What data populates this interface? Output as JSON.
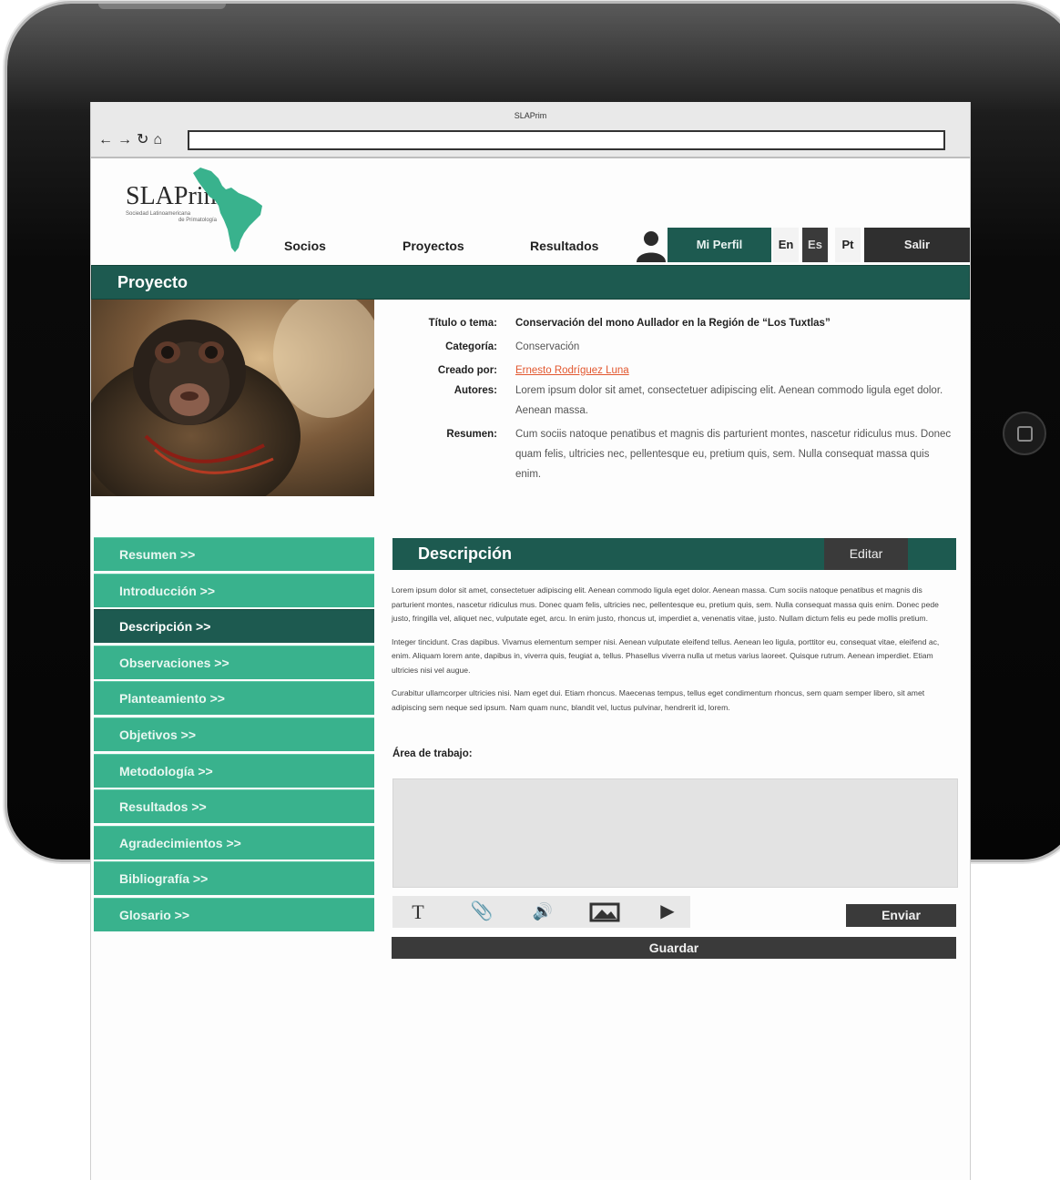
{
  "browser": {
    "title": "SLAPrim",
    "address": ""
  },
  "logo": {
    "name": "SLAPrim",
    "subtitle_line1": "Sociedad Latinoamericana",
    "subtitle_line2": "de Primatología"
  },
  "nav": {
    "socios": "Socios",
    "proyectos": "Proyectos",
    "resultados": "Resultados",
    "profile": "Mi Perfil",
    "lang_en": "En",
    "lang_es": "Es",
    "lang_pt": "Pt",
    "logout": "Salir"
  },
  "section": {
    "title": "Proyecto"
  },
  "project": {
    "title_label": "Título o tema:",
    "title_value": "Conservación del mono Aullador en la Región de “Los Tuxtlas”",
    "category_label": "Categoría:",
    "category_value": "Conservación",
    "creator_label": "Creado por:",
    "creator_value": "Ernesto Rodríguez Luna",
    "authors_label": "Autores:",
    "authors_value": "Lorem ipsum dolor sit amet, consectetuer adipiscing elit. Aenean commodo ligula eget dolor. Aenean massa.",
    "summary_label": "Resumen:",
    "summary_value": "Cum sociis natoque penatibus et magnis dis parturient montes, nascetur ridiculus mus. Donec quam felis, ultricies nec, pellentesque eu, pretium quis, sem. Nulla consequat massa quis enim."
  },
  "sidebar": {
    "items": [
      {
        "label": "Resumen >>"
      },
      {
        "label": "Introducción >>"
      },
      {
        "label": "Descripción >>"
      },
      {
        "label": "Observaciones >>"
      },
      {
        "label": "Planteamiento >>"
      },
      {
        "label": "Objetivos >>"
      },
      {
        "label": "Metodología >>"
      },
      {
        "label": "Resultados >>"
      },
      {
        "label": "Agradecimientos >>"
      },
      {
        "label": "Bibliografía >>"
      },
      {
        "label": "Glosario >>"
      }
    ],
    "active_index": 2
  },
  "description": {
    "title": "Descripción",
    "edit": "Editar",
    "paragraph1": "Lorem ipsum dolor sit amet, consectetuer adipiscing elit. Aenean commodo ligula eget dolor. Aenean massa. Cum sociis natoque penatibus et magnis dis parturient montes, nascetur ridiculus mus. Donec quam felis, ultricies nec, pellentesque eu, pretium quis, sem. Nulla consequat massa quis enim. Donec pede justo, fringilla vel, aliquet nec, vulputate eget, arcu. In enim justo, rhoncus ut, imperdiet a, venenatis vitae, justo. Nullam dictum felis eu pede mollis pretium.",
    "paragraph2": "Integer tincidunt. Cras dapibus. Vivamus elementum semper nisi. Aenean vulputate eleifend tellus. Aenean leo ligula, porttitor eu, consequat vitae, eleifend ac, enim. Aliquam lorem ante, dapibus in, viverra quis, feugiat a, tellus. Phasellus viverra nulla ut metus varius laoreet. Quisque rutrum. Aenean imperdiet. Etiam ultricies nisi vel augue.",
    "paragraph3": "Curabitur ullamcorper ultricies nisi. Nam eget dui. Etiam rhoncus. Maecenas tempus, tellus eget condimentum rhoncus, sem quam semper libero, sit amet adipiscing sem neque sed ipsum. Nam quam nunc, blandit vel, luctus pulvinar, hendrerit id, lorem.",
    "work_label": "Área de trabajo:",
    "work_value": ""
  },
  "toolbar": {
    "text_glyph": "T",
    "attach_glyph": "📎",
    "audio_glyph": "🔊",
    "video_glyph": "▶"
  },
  "actions": {
    "send": "Enviar",
    "save": "Guardar"
  },
  "colors": {
    "primary_dark": "#1d5a50",
    "primary_light": "#39b28d",
    "dark_button": "#3a3a3a",
    "link": "#e2572f"
  }
}
